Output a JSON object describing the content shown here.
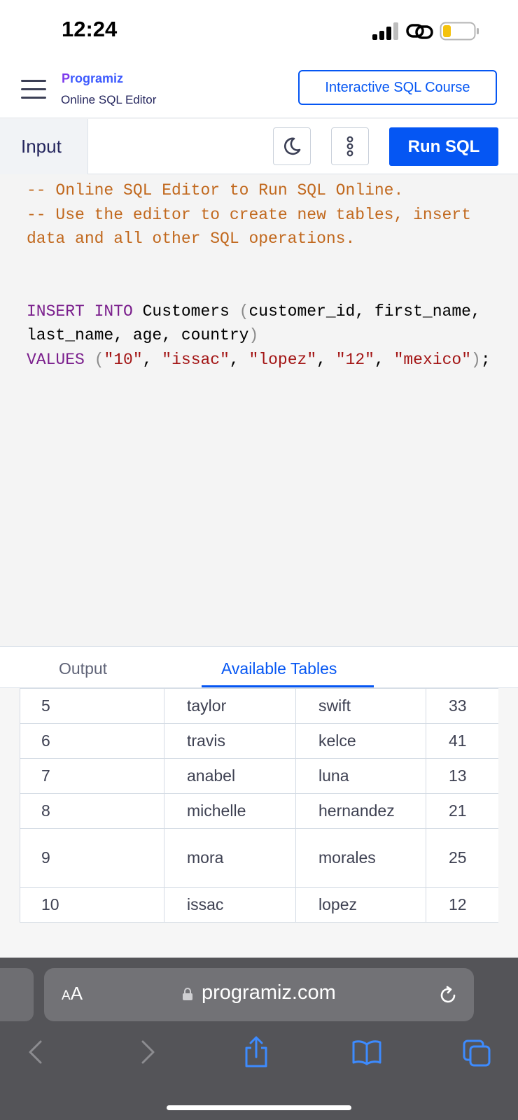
{
  "status_bar": {
    "time": "12:24"
  },
  "header": {
    "logo_text": "rogramiz",
    "logo_initial": "P",
    "subtitle": "Online SQL Editor",
    "course_button": "Interactive SQL Course"
  },
  "toolbar": {
    "input_tab": "Input",
    "run_button": "Run SQL"
  },
  "editor": {
    "comment_1": "-- Online SQL Editor to Run SQL Online.",
    "comment_2": "-- Use the editor to create new tables, insert data and all other SQL operations.",
    "kw_insert": "INSERT INTO",
    "table_name": " Customers ",
    "open_paren": "(",
    "columns": "customer_id, first_name, last_name, age, country",
    "close_paren": ")",
    "kw_values": "VALUES",
    "v1": "\"10\"",
    "v2": "\"issac\"",
    "v3": "\"lopez\"",
    "v4": "\"12\"",
    "v5": "\"mexico\"",
    "terminator": ";"
  },
  "output_tabs": {
    "output": "Output",
    "available_tables": "Available Tables",
    "active": "Available Tables"
  },
  "results": {
    "rows": [
      [
        "5",
        "taylor",
        "swift",
        "33"
      ],
      [
        "6",
        "travis",
        "kelce",
        "41"
      ],
      [
        "7",
        "anabel",
        "luna",
        "13"
      ],
      [
        "8",
        "michelle",
        "hernandez",
        "21"
      ],
      [
        "9",
        "mora",
        "morales",
        "25"
      ],
      [
        "10",
        "issac",
        "lopez",
        "12"
      ]
    ]
  },
  "browser": {
    "aa_label_small": "A",
    "aa_label_large": "A",
    "url": "programiz.com"
  },
  "colors": {
    "accent": "#0556f3",
    "comment": "#c1681d",
    "keyword": "#7a1e8c",
    "string": "#a31515",
    "battery": "#f4c20d"
  },
  "icons": [
    "hamburger-icon",
    "moon-icon",
    "more-vertical-icon",
    "lock-icon",
    "reload-icon",
    "back-icon",
    "forward-icon",
    "share-icon",
    "bookmarks-icon",
    "tabs-icon"
  ]
}
